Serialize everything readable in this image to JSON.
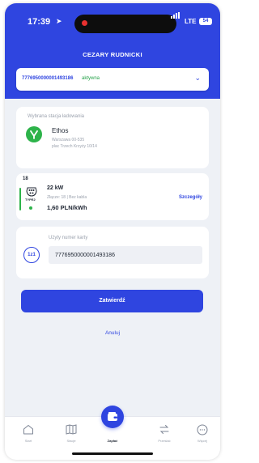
{
  "status_bar": {
    "time": "17:39",
    "network": "LTE",
    "battery": "54"
  },
  "header": {
    "user_name": "CEZARY RUDNICKI"
  },
  "card_selector": {
    "number": "7776950000001493186",
    "status": "aktywna"
  },
  "station": {
    "label": "Wybrana stacja ładowania",
    "name": "Ethos",
    "address_line1": "Warszawa 00-535",
    "address_line2": "plac Trzech Krzyży 10/14"
  },
  "connector": {
    "number": "18",
    "type": "TYPE2",
    "power": "22 kW",
    "details": "Złącze: 18 | Bez kabla",
    "price": "1,60 PLN/kWh",
    "details_link": "Szczegóły"
  },
  "card_number_section": {
    "icon_text": "1z1",
    "label": "Użyty numer karty",
    "value": "7776950000001493186"
  },
  "actions": {
    "confirm": "Zatwierdź",
    "cancel": "Anuluj"
  },
  "bottom_nav": {
    "items": [
      {
        "label": "Start",
        "icon": "home-icon"
      },
      {
        "label": "Stacje",
        "icon": "map-icon"
      },
      {
        "label": "Zapłać",
        "icon": "wallet-icon"
      },
      {
        "label": "Przesłać",
        "icon": "transfer-icon"
      },
      {
        "label": "Więcej",
        "icon": "more-icon"
      }
    ]
  },
  "colors": {
    "primary": "#2f45e0",
    "success": "#2db34a",
    "background": "#eef1f6"
  }
}
